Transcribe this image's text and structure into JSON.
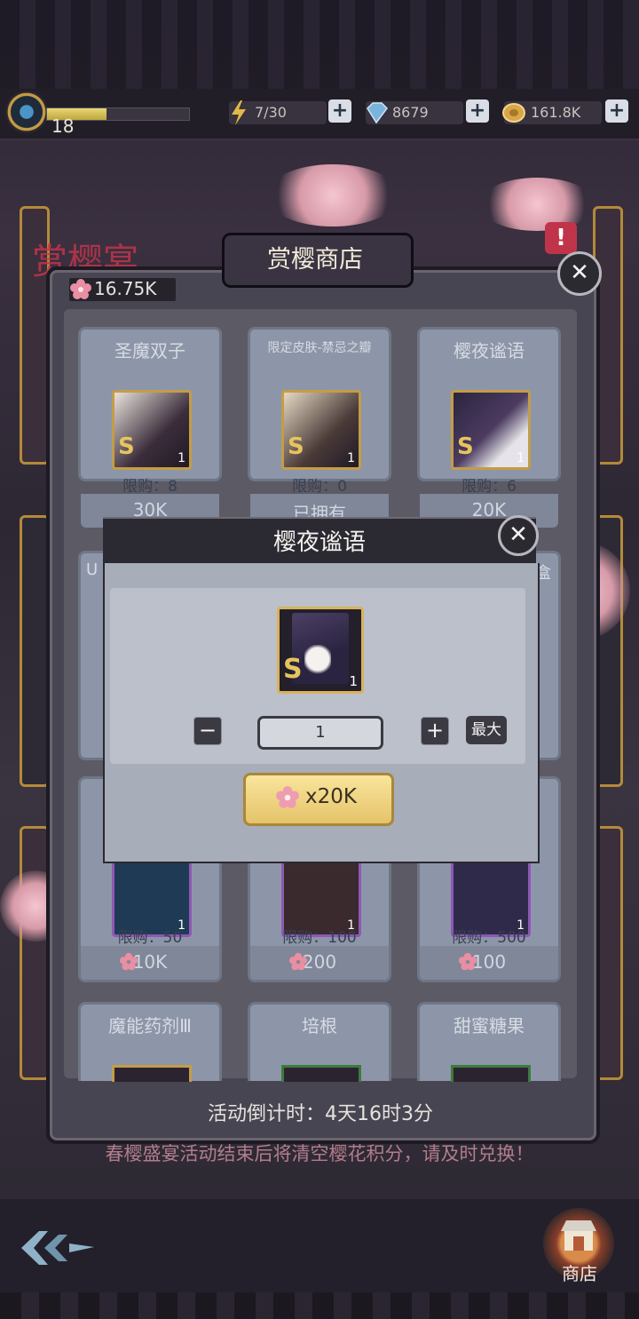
{
  "hud": {
    "level": "18",
    "xp_fraction": 0.42,
    "stamina": "7/30",
    "diamonds": "8679",
    "coins": "161.8K",
    "plus": "+"
  },
  "shop": {
    "title": "赏樱商店",
    "points": "16.75K",
    "close": "✕",
    "countdown": "活动倒计时：4天16时3分",
    "notice": "春樱盛宴活动结束后将清空樱花积分，请及时兑换！",
    "background_banner": "赏樱宴",
    "items_row1": [
      {
        "name": "圣魔双子",
        "limit": "限购：8",
        "price": "30K",
        "count": "1",
        "badge": "S"
      },
      {
        "name": "限定皮肤-禁忌之瓣",
        "limit": "限购：0",
        "price": "已拥有",
        "count": "1",
        "badge": "S"
      },
      {
        "name": "樱夜谧语",
        "limit": "限购：6",
        "price": "20K",
        "count": "1",
        "badge": "S"
      }
    ],
    "items_row3": [
      {
        "limit": "限购：50",
        "price": "10K",
        "count": "1"
      },
      {
        "limit": "限购：100",
        "price": "200",
        "count": "1"
      },
      {
        "limit": "限购：500",
        "price": "100",
        "count": "1"
      }
    ],
    "items_row4": [
      {
        "name": "魔能药剂Ⅲ"
      },
      {
        "name": "培根"
      },
      {
        "name": "甜蜜糖果"
      }
    ],
    "partial_labels": {
      "left_row2": "U",
      "right_row2": "盒"
    }
  },
  "modal": {
    "title": "樱夜谧语",
    "close": "✕",
    "item_badge": "S",
    "item_count": "1",
    "minus": "−",
    "quantity": "1",
    "plus": "+",
    "max": "最大",
    "buy_price": "x20K"
  },
  "nav": {
    "shop_label": "商店"
  }
}
